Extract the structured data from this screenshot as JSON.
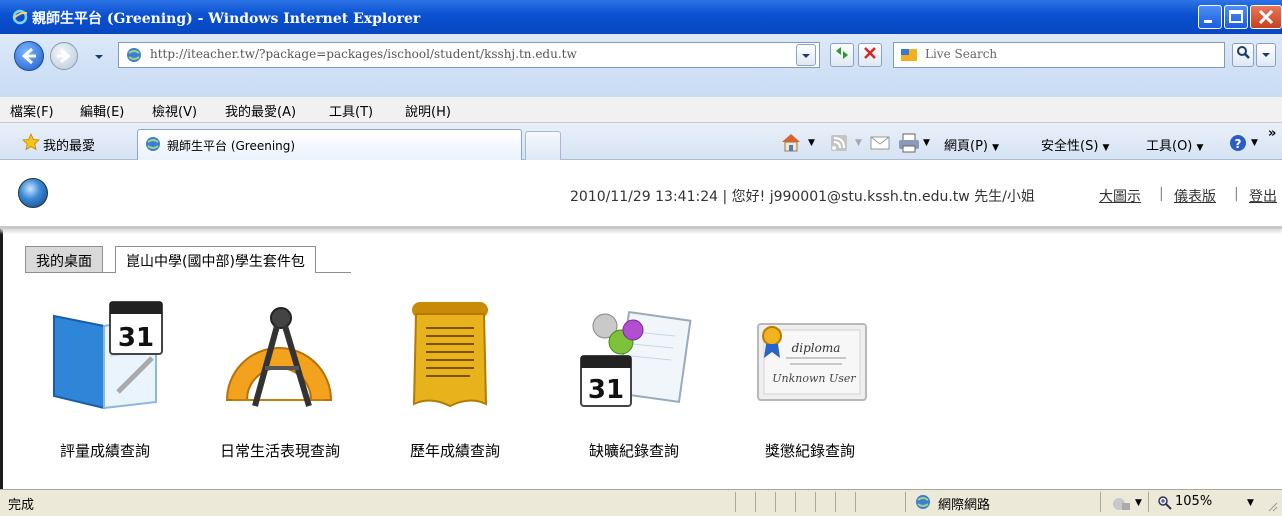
{
  "window": {
    "title": "親師生平台 (Greening) - Windows Internet Explorer"
  },
  "address_bar": {
    "url": "http://iteacher.tw/?package=packages/ischool/student/ksshj.tn.edu.tw",
    "search_placeholder": "Live Search"
  },
  "menu": {
    "items": [
      "檔案(F)",
      "編輯(E)",
      "檢視(V)",
      "我的最愛(A)",
      "工具(T)",
      "說明(H)"
    ]
  },
  "favorites_bar": {
    "favorites_label": "我的最愛",
    "tab_title": "親師生平台 (Greening)",
    "commands": {
      "page": "網頁(P)",
      "safety": "安全性(S)",
      "tools": "工具(O)"
    }
  },
  "header": {
    "datetime_greeting": "2010/11/29 13:41:24 | 您好! j990001@stu.kssh.tn.edu.tw 先生/小姐",
    "links": [
      "大圖示",
      "儀表版",
      "登出"
    ]
  },
  "tabs": [
    "我的桌面",
    "崑山中學(國中部)學生套件包"
  ],
  "apps": [
    {
      "label": "評量成績查詢",
      "icon": "notebook-calendar-icon"
    },
    {
      "label": "日常生活表現查詢",
      "icon": "compass-protractor-icon"
    },
    {
      "label": "歷年成績查詢",
      "icon": "parchment-scroll-icon"
    },
    {
      "label": "缺曠紀錄查詢",
      "icon": "calendar-flask-icon"
    },
    {
      "label": "獎懲紀錄查詢",
      "icon": "diploma-certificate-icon"
    }
  ],
  "status_bar": {
    "status": "完成",
    "zone": "網際網路",
    "zoom": "105%"
  }
}
